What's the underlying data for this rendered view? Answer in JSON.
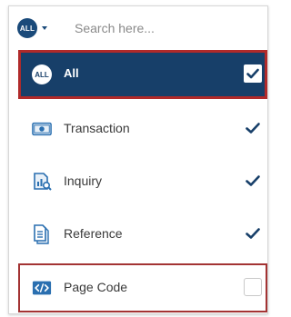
{
  "search": {
    "badge": "ALL",
    "placeholder": "Search here..."
  },
  "items": [
    {
      "label": "All",
      "icon": "all-badge-icon",
      "checked": true
    },
    {
      "label": "Transaction",
      "icon": "transaction-icon",
      "checked": true
    },
    {
      "label": "Inquiry",
      "icon": "inquiry-icon",
      "checked": true
    },
    {
      "label": "Reference",
      "icon": "reference-icon",
      "checked": true
    },
    {
      "label": "Page Code",
      "icon": "code-icon",
      "checked": false
    }
  ],
  "colors": {
    "accent": "#173f69",
    "highlight_border": "#b02a2a",
    "icon_blue": "#2a6fb0",
    "check": "#173f69"
  }
}
